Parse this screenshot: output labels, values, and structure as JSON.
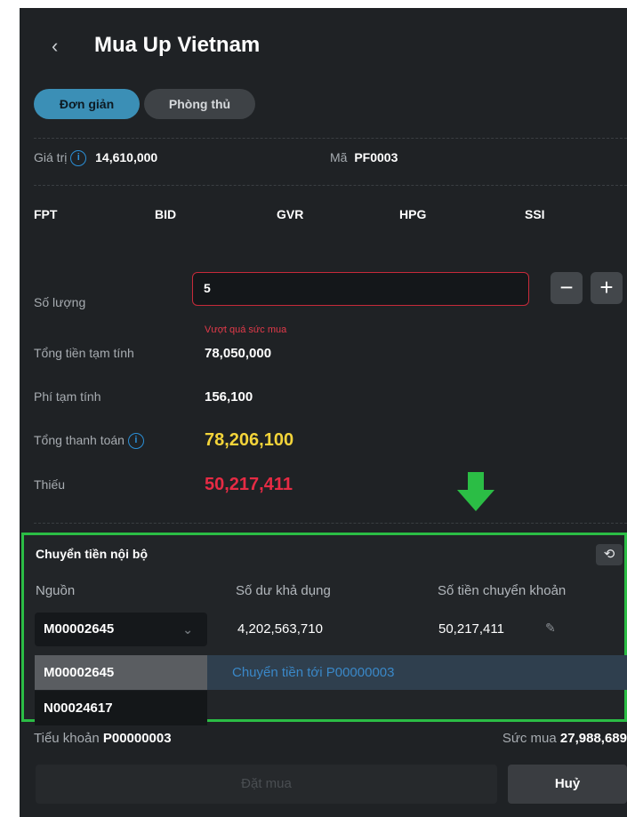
{
  "header": {
    "back_icon": "‹",
    "title": "Mua Up Vietnam"
  },
  "tabs": [
    {
      "label": "Đơn giản"
    },
    {
      "label": "Phòng thủ"
    }
  ],
  "info_row": {
    "value_label": "Giá trị",
    "value": "14,610,000",
    "code_label": "Mã",
    "code": "PF0003"
  },
  "symbols": [
    "FPT",
    "BID",
    "GVR",
    "HPG",
    "SSI"
  ],
  "order": {
    "qty_label": "Số lượng",
    "qty_value": "5",
    "qty_error": "Vượt quá sức mua",
    "minus": "−",
    "plus": "+",
    "subtotal_label": "Tổng tiền tạm tính",
    "subtotal": "78,050,000",
    "fee_label": "Phí tạm tính",
    "fee": "156,100",
    "total_label": "Tổng thanh toán",
    "total": "78,206,100",
    "missing_label": "Thiếu",
    "missing": "50,217,411"
  },
  "transfer": {
    "title": "Chuyển tiền nội bộ",
    "refresh_icon": "⟲",
    "col_source": "Nguồn",
    "col_available": "Số dư khả dụng",
    "col_amount": "Số tiền chuyển khoản",
    "selected_account": "M00002645",
    "available": "4,202,563,710",
    "amount": "50,217,411",
    "pen_icon": "✎",
    "options": [
      "M00002645",
      "N00024617"
    ],
    "transfer_to": "Chuyển tiền tới P00000003"
  },
  "footer": {
    "subaccount_label": "Tiểu khoản",
    "subaccount": "P00000003",
    "power_label": "Sức mua",
    "power": "27,988,689",
    "order_btn": "Đặt mua",
    "cancel_btn": "Huỷ"
  },
  "colors": {
    "accent": "#3b8fb6",
    "error": "#e62b44",
    "warning": "#f3d43a",
    "highlight": "#2bbd45"
  }
}
